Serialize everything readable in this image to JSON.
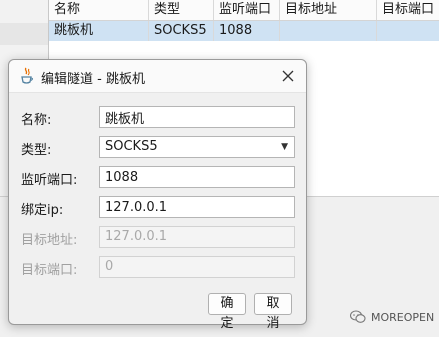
{
  "table": {
    "headers": [
      "名称",
      "类型",
      "监听端口",
      "目标地址",
      "目标端口"
    ],
    "rows": [
      [
        "跳板机",
        "SOCKS5",
        "1088",
        "",
        ""
      ]
    ]
  },
  "dialog": {
    "title": "编辑隧道 - 跳板机",
    "fields": {
      "name": {
        "label": "名称:",
        "value": "跳板机"
      },
      "type": {
        "label": "类型:",
        "value": "SOCKS5"
      },
      "listen_port": {
        "label": "监听端口:",
        "value": "1088"
      },
      "bind_ip": {
        "label": "绑定ip:",
        "value": "127.0.0.1"
      },
      "target_addr": {
        "label": "目标地址:",
        "placeholder": "127.0.0.1"
      },
      "target_port": {
        "label": "目标端口:",
        "placeholder": "0"
      }
    },
    "buttons": {
      "ok": "确定",
      "cancel": "取消"
    }
  },
  "watermark": "MOREOPEN",
  "icons": {
    "title": "java-cup-icon",
    "close": "close-icon",
    "dropdown": "chevron-down-icon",
    "watermark": "wechat-icon"
  }
}
